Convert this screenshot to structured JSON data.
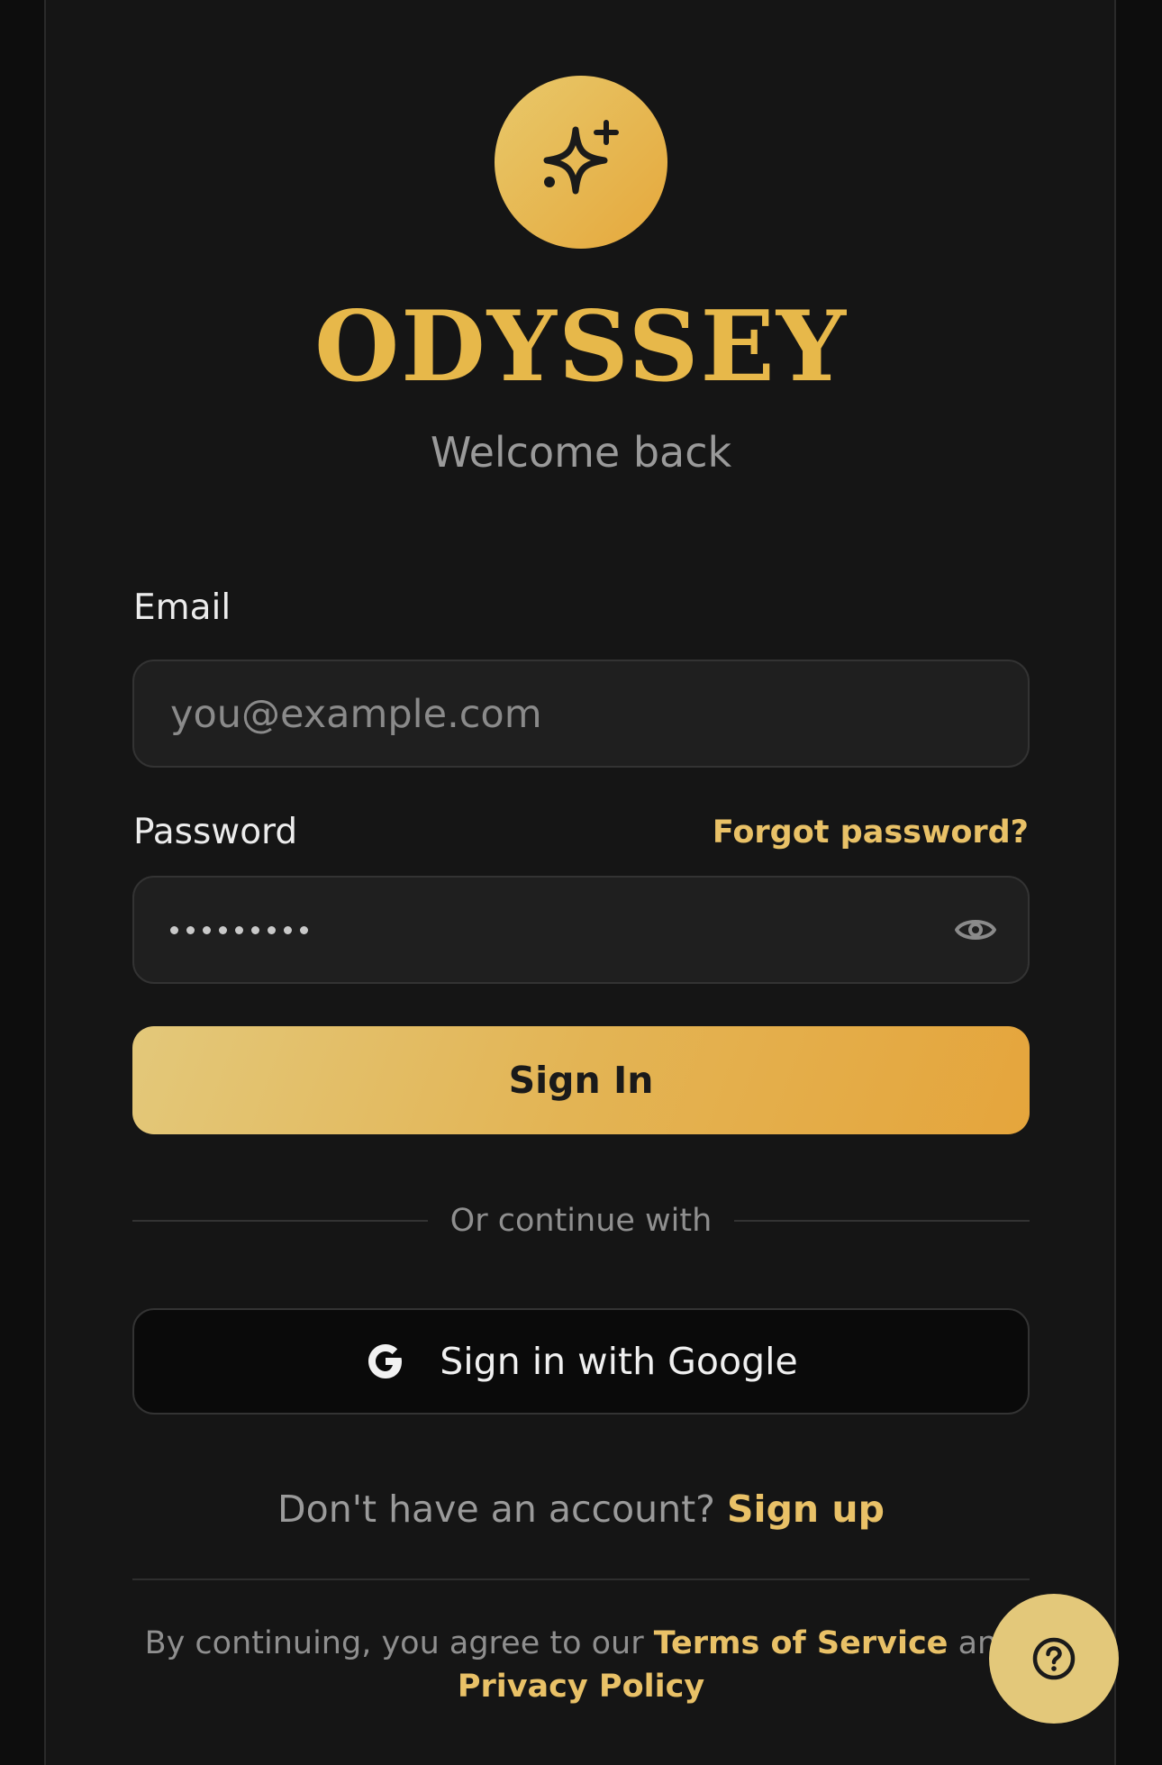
{
  "brand": {
    "name": "ODYSSEY",
    "tagline": "Welcome back",
    "logo_icon": "sparkles-icon"
  },
  "form": {
    "email_label": "Email",
    "email_placeholder": "you@example.com",
    "email_value": "",
    "password_label": "Password",
    "forgot_link": "Forgot password?",
    "password_mask_length": 9,
    "toggle_icon": "eye-icon",
    "submit_label": "Sign In"
  },
  "divider": {
    "text": "Or continue with"
  },
  "google": {
    "label": "Sign in with Google",
    "icon": "google-icon"
  },
  "signup": {
    "prompt": "Don't have an account?",
    "link": "Sign up"
  },
  "legal": {
    "prefix": "By continuing, you agree to our",
    "terms": "Terms of Service",
    "joiner": "and",
    "privacy": "Privacy Policy"
  },
  "help": {
    "icon": "help-icon"
  },
  "colors": {
    "accent": "#e7b84a",
    "accent_light": "#e3c87a",
    "background": "#151515"
  }
}
